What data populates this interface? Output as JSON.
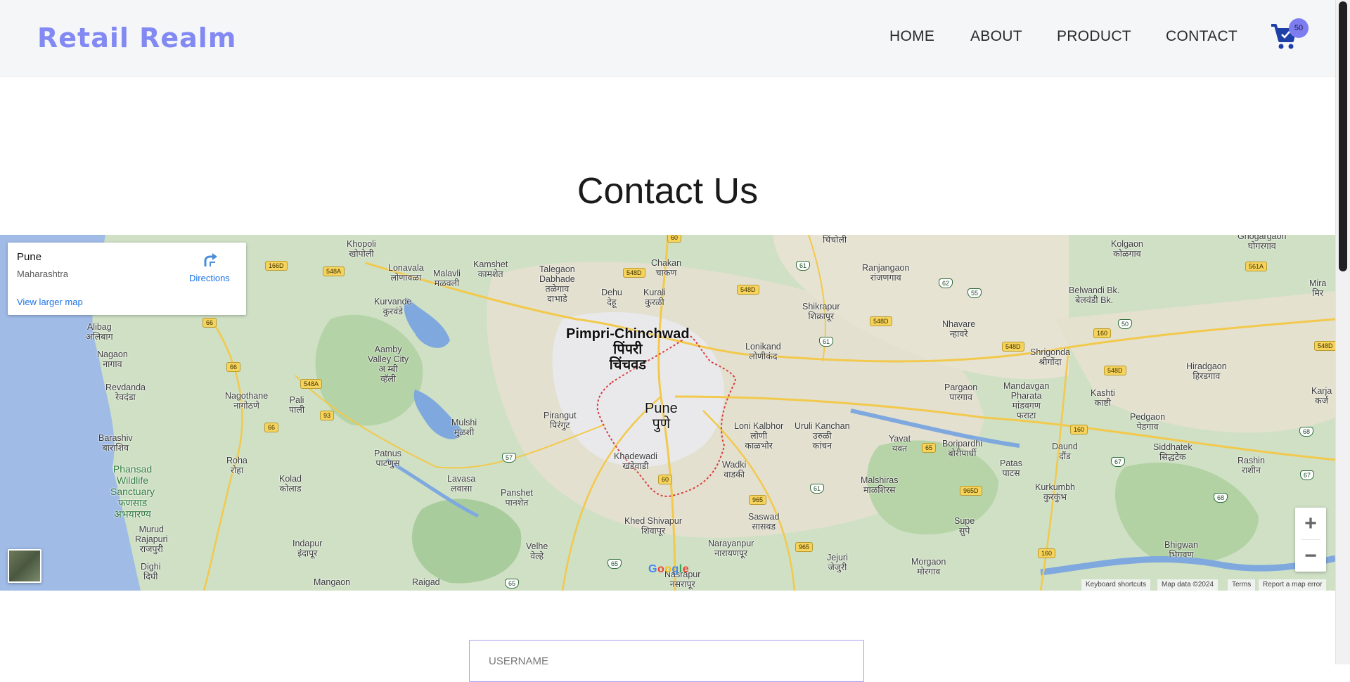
{
  "brand": "Retail Realm",
  "nav": {
    "home": "HOME",
    "about": "ABOUT",
    "product": "PRODUCT",
    "contact": "CONTACT",
    "cart_count": "50"
  },
  "page_title": "Contact Us",
  "map": {
    "place_name": "Pune",
    "place_region": "Maharashtra",
    "directions": "Directions",
    "view_larger": "View larger map",
    "zoom_in": "+",
    "zoom_out": "−",
    "google": "Google",
    "keyboard_shortcuts": "Keyboard shortcuts",
    "map_data": "Map data ©2024",
    "terms": "Terms",
    "report": "Report a map error",
    "labels": {
      "pimpri": "Pimpri-Chinchwad\nपिंपरी\nचिंचवड",
      "pune": "Pune\nपुणे",
      "khopoli": "Khopoli\nखोपोली",
      "lonavala": "Lonavala\nलोणावळा",
      "malavli": "Malavli\nमळवली",
      "kamshet": "Kamshet\nकामशेत",
      "talegaon": "Talegaon\nDabhade\nतळेगाव\nदाभाडे",
      "chakan": "Chakan\nचाकण",
      "dehu": "Dehu\nदेहू",
      "kurali": "Kurali\nकुरळी",
      "chincholi": "चिंचोली",
      "ranjangaon": "Ranjangaon\nरांजणगाव",
      "kolgaon": "Kolgaon\nकोळगाव",
      "ghogargaon": "Ghogargaon\nघोगरगाव",
      "mira": "Mira\nमिर",
      "belwandi": "Belwandi Bk.\nबेलवंडी Bk.",
      "kurvande": "Kurvande\nकुरवंडे",
      "shikrapur": "Shikrapur\nशिक्रापूर",
      "nhavare": "Nhavare\nन्हावरे",
      "alibag": "Alibag\nअलिबाग",
      "nagaon": "Nagaon\nनागाव",
      "aamby": "Aamby\nValley City\nअ म्बी\nव्हॅली",
      "lonikand": "Lonikand\nलोणीकंद",
      "shrigonda": "Shrigonda\nश्रीगोंदा",
      "hiradgaon": "Hiradgaon\nहिरडगाव",
      "revdanda": "Revdanda\nरेवदंडा",
      "nagothane": "Nagothane\nनागोठणे",
      "pali": "Pali\nपाली",
      "pargaon": "Pargaon\nपारगाव",
      "mandavgan": "Mandavgan\nPharata\nमांडवगण\nफराटा",
      "kashti": "Kashti\nकाष्टी",
      "karjat": "Karja\nकर्ज",
      "mulshi": "Mulshi\nमुळशी",
      "pirangut": "Pirangut\nपिरंगुट",
      "loni_kalbhor": "Loni Kalbhor\nलोणी\nकाळभोर",
      "uruli": "Uruli Kanchan\nउरुळी\nकांचन",
      "yavat": "Yavat\nयवत",
      "boripardhi": "Boripardhi\nबोरीपार्धी",
      "pedgaon": "Pedgaon\nपेडगाव",
      "barashiv": "Barashiv\nबाराशिव",
      "phansad": "Phansad\nWildlife\nSanctuary\nफणसाड\nअभयारण्य",
      "roha": "Roha\nरोहा",
      "patnus": "Patnus\nपाटणुस",
      "khadewadi": "Khadewadi\nखडेवाडी",
      "wadki": "Wadki\nवाडकी",
      "daund": "Daund\nदौंड",
      "siddhatek": "Siddhatek\nसिद्धटेक",
      "rashin": "Rashin\nराशीन",
      "patas": "Patas\nपाटस",
      "kolad": "Kolad\nकोलाड",
      "lavasa": "Lavasa\nलवासा",
      "panshet": "Panshet\nपानशेत",
      "malshiras": "Malshiras\nमाळशिरस",
      "kurkumbh": "Kurkumbh\nकुरकुंभ",
      "murud": "Murud\nRajapuri\nराजपुरी",
      "khed_shivapur": "Khed Shivapur\nशिवापूर",
      "saswad": "Saswad\nसासवड",
      "supe": "Supe\nसुपे",
      "bhigwan": "Bhigwan\nभिगवण",
      "dighi": "Dighi\nदिघी",
      "indapur": "Indapur\nइंदापूर",
      "velhe": "Velhe\nवेल्हे",
      "narayanpur": "Narayanpur\nनारायणपूर",
      "jejuri": "Jejuri\nजेजुरी",
      "morgaon": "Morgaon\nमोरगाव",
      "mangaon": "Mangaon",
      "raigad": "Raigad",
      "nasrapur": "Nasrapur\nनसरापूर"
    },
    "shields": {
      "s166d": "166D",
      "s548a": "548A",
      "s548a2": "548A",
      "s60": "60",
      "s548d": "548D",
      "s548d2": "548D",
      "s548d3": "548D",
      "s548d4": "548D",
      "s548d5": "548D",
      "s548d6": "548D",
      "s561a": "561A",
      "s66": "66",
      "s66b": "66",
      "s66c": "66",
      "s160": "160",
      "s160b": "160",
      "s160c": "160",
      "s93": "93",
      "s60b": "60",
      "s965": "965",
      "s965b": "965",
      "s965d": "965D",
      "s65": "65",
      "n61": "61",
      "n61b": "61",
      "n61c": "61",
      "n62": "62",
      "n55": "55",
      "n50": "50",
      "n57": "57",
      "n67": "67",
      "n67b": "67",
      "n68": "68",
      "n68b": "68",
      "n65": "65",
      "n65b": "65"
    }
  },
  "form": {
    "username_placeholder": "USERNAME"
  },
  "colors": {
    "brand": "#8289f3",
    "badge": "#7d7df0",
    "cart": "#1f3fa8",
    "input_border": "#a99ef0",
    "link": "#1a73e8"
  }
}
